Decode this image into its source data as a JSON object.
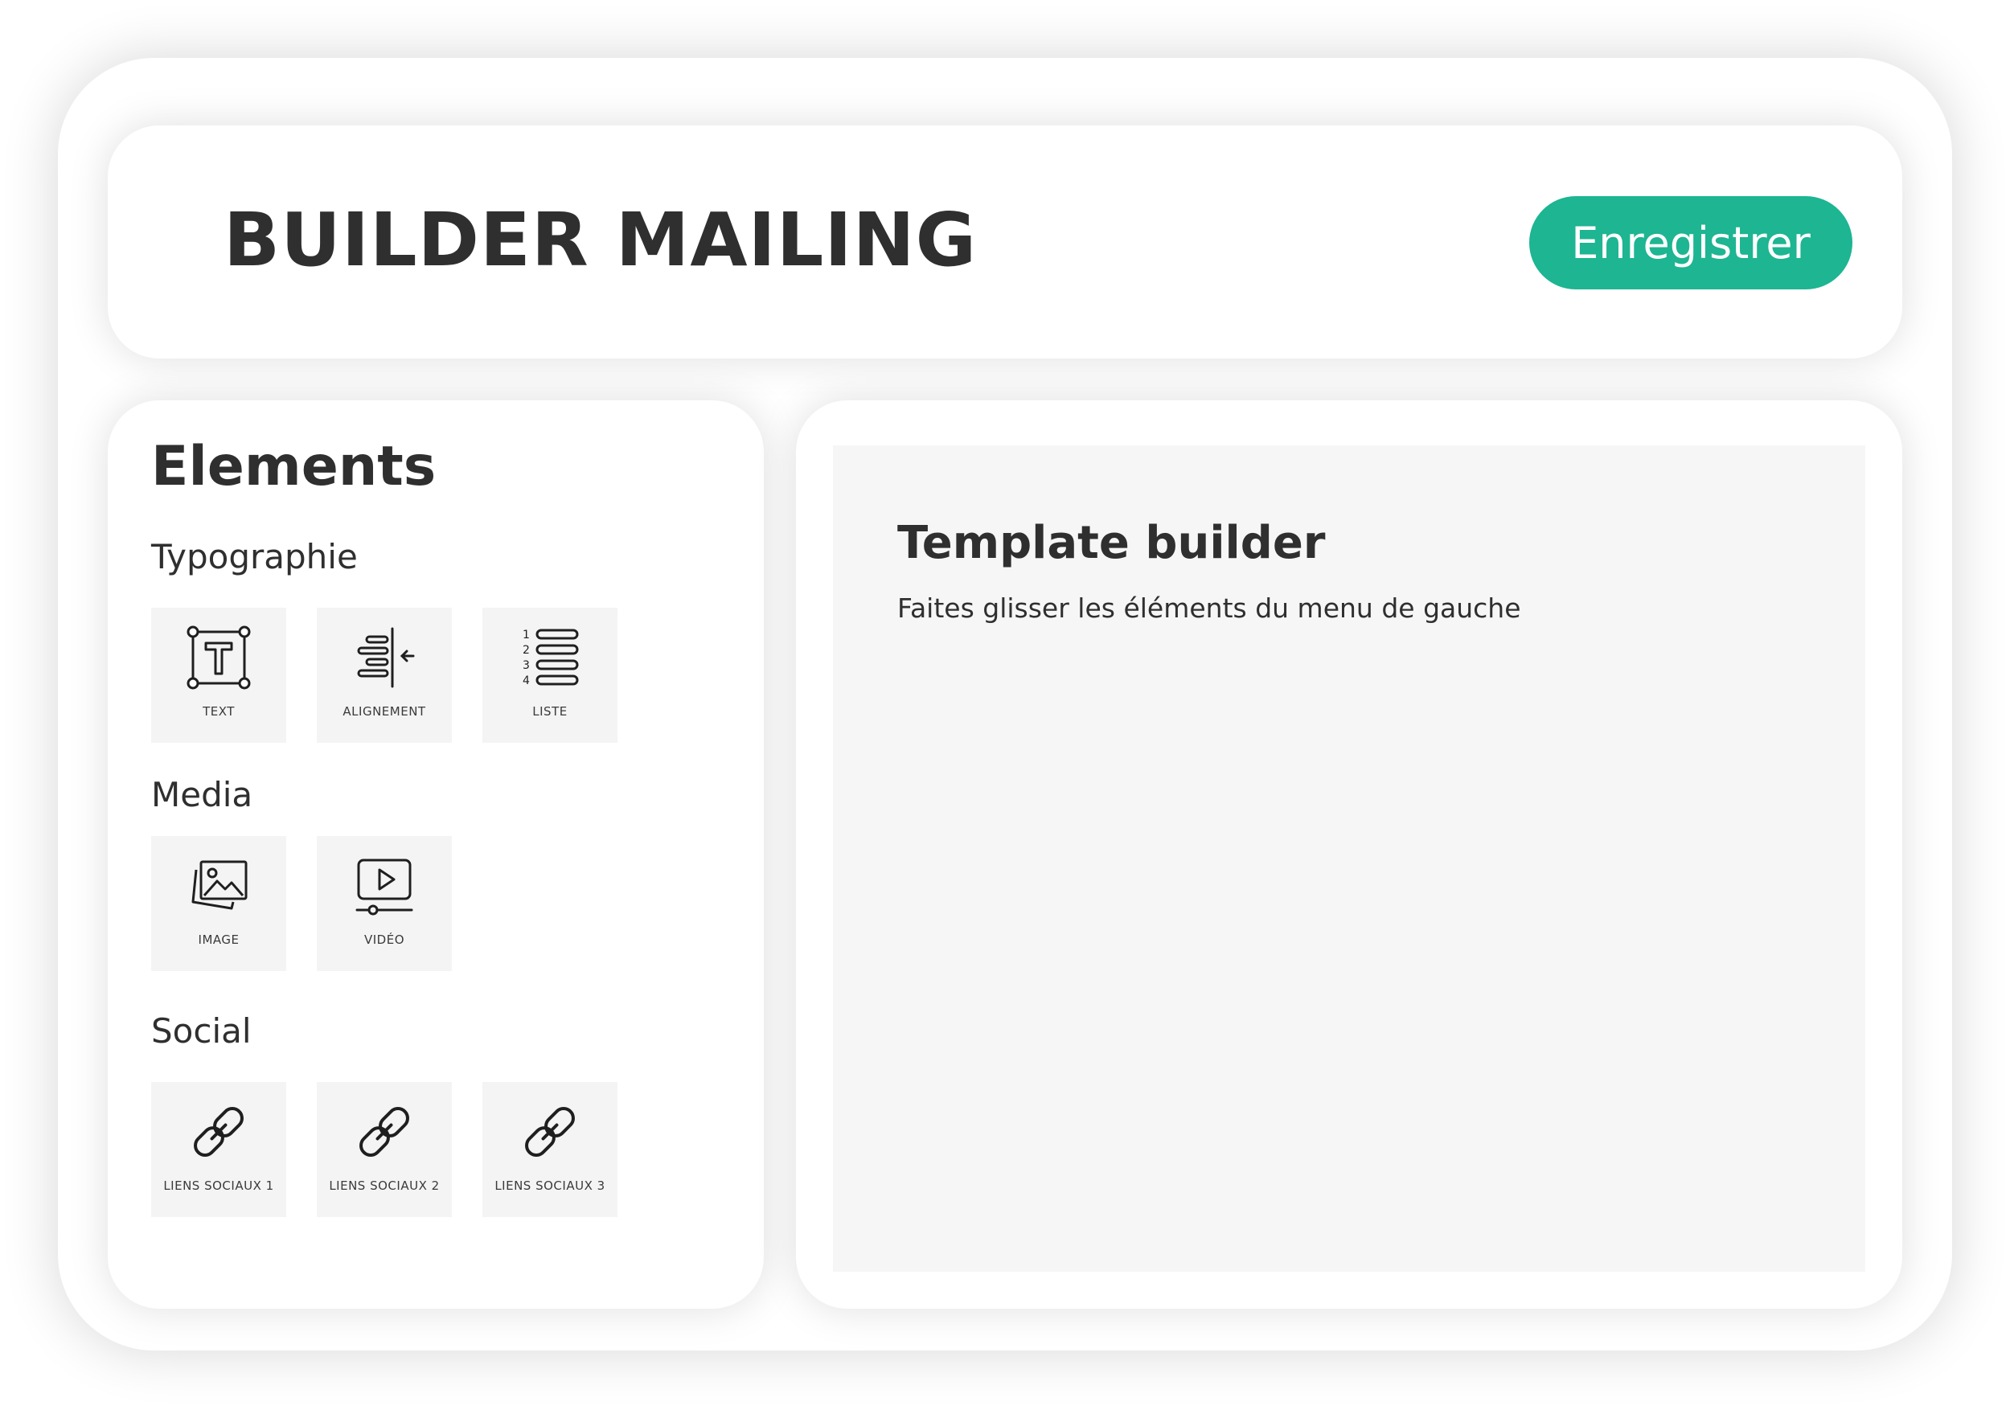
{
  "header": {
    "title": "BUILDER MAILING",
    "save_label": "Enregistrer",
    "accent_color": "#1db592"
  },
  "sidebar": {
    "title": "Elements",
    "sections": [
      {
        "title": "Typographie",
        "items": [
          {
            "label": "TEXT",
            "icon": "text-box-icon"
          },
          {
            "label": "ALIGNEMENT",
            "icon": "align-right-icon"
          },
          {
            "label": "LISTE",
            "icon": "numbered-list-icon"
          }
        ]
      },
      {
        "title": "Media",
        "items": [
          {
            "label": "IMAGE",
            "icon": "image-icon"
          },
          {
            "label": "VIDÉO",
            "icon": "video-icon"
          }
        ]
      },
      {
        "title": "Social",
        "items": [
          {
            "label": "LIENS SOCIAUX 1",
            "icon": "link-icon"
          },
          {
            "label": "LIENS SOCIAUX 2",
            "icon": "link-icon"
          },
          {
            "label": "LIENS SOCIAUX 3",
            "icon": "link-icon"
          }
        ]
      }
    ]
  },
  "workspace": {
    "title": "Template builder",
    "hint": "Faites glisser les éléments du menu de gauche"
  }
}
